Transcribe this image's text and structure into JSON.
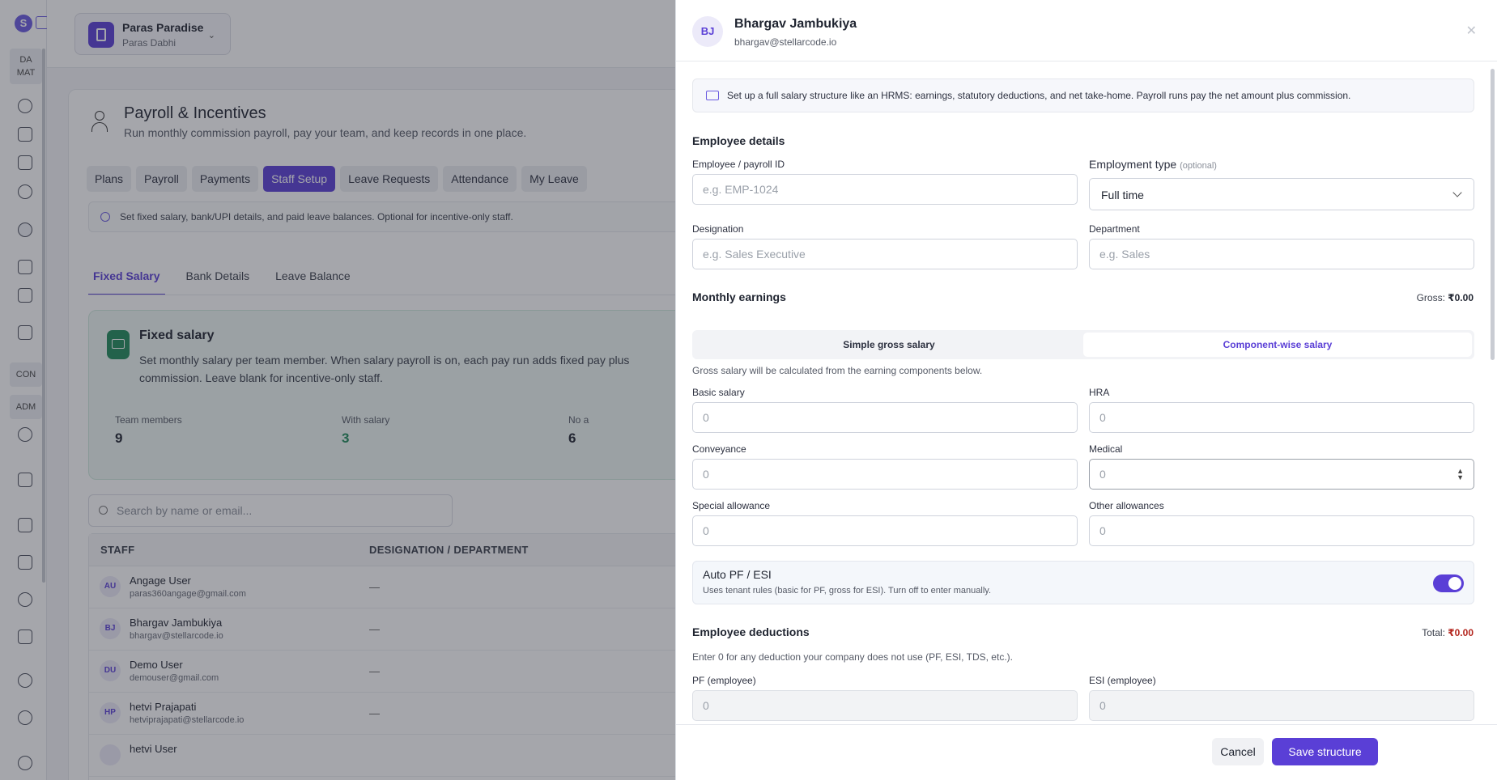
{
  "sidebar": {
    "sections": [
      "DA MAT",
      "CON",
      "ADM"
    ],
    "icons": [
      "dashboard-icon",
      "megaphone-icon",
      "document-icon",
      "users-icon",
      "payroll-icon",
      "building-icon",
      "presentation-icon",
      "checklist-icon",
      "whatsapp-icon",
      "phone-icon",
      "mail-icon",
      "receipt-icon",
      "network-icon",
      "ledger-icon",
      "user-add-icon",
      "help-user-icon",
      "profile-icon"
    ]
  },
  "org": {
    "name": "Paras Paradise",
    "owner": "Paras Dabhi"
  },
  "page": {
    "title": "Payroll & Incentives",
    "subtitle": "Run monthly commission payroll, pay your team, and keep records in one place."
  },
  "tabs": [
    "Plans",
    "Payroll",
    "Payments",
    "Staff Setup",
    "Leave Requests",
    "Attendance",
    "My Leave"
  ],
  "active_tab": "Staff Setup",
  "notice": "Set fixed salary, bank/UPI details, and paid leave balances. Optional for incentive-only staff.",
  "subtabs": [
    "Fixed Salary",
    "Bank Details",
    "Leave Balance"
  ],
  "fixed_card": {
    "title": "Fixed salary",
    "description": "Set monthly salary per team member. When salary payroll is on, each pay run adds fixed pay plus commission. Leave blank for incentive-only staff.",
    "stats": [
      {
        "label": "Team members",
        "value": "9"
      },
      {
        "label": "With salary",
        "value": "3"
      },
      {
        "label": "No a",
        "value": "6"
      }
    ]
  },
  "search": {
    "placeholder": "Search by name or email..."
  },
  "table": {
    "headers": [
      "STAFF",
      "DESIGNATION / DEPARTMENT"
    ],
    "rows": [
      {
        "initials": "AU",
        "name": "Angage User",
        "email": "paras360angage@gmail.com",
        "designation": "—"
      },
      {
        "initials": "BJ",
        "name": "Bhargav Jambukiya",
        "email": "bhargav@stellarcode.io",
        "designation": "—"
      },
      {
        "initials": "DU",
        "name": "Demo User",
        "email": "demouser@gmail.com",
        "designation": "—"
      },
      {
        "initials": "HP",
        "name": "hetvi Prajapati",
        "email": "hetviprajapati@stellarcode.io",
        "designation": "—"
      },
      {
        "initials": "",
        "name": "hetvi User",
        "email": "",
        "designation": ""
      }
    ]
  },
  "drawer": {
    "initials": "BJ",
    "name": "Bhargav Jambukiya",
    "email": "bhargav@stellarcode.io",
    "info": "Set up a full salary structure like an HRMS: earnings, statutory deductions, and net take-home. Payroll runs pay the net amount plus commission.",
    "employee_details": {
      "heading": "Employee details",
      "payroll_id_label": "Employee / payroll ID",
      "payroll_id_placeholder": "e.g. EMP-1024",
      "employment_type_label": "Employment type",
      "employment_type_optional": "(optional)",
      "employment_type_value": "Full time",
      "designation_label": "Designation",
      "designation_placeholder": "e.g. Sales Executive",
      "department_label": "Department",
      "department_placeholder": "e.g. Sales"
    },
    "earnings": {
      "heading": "Monthly earnings",
      "gross_label": "Gross:",
      "gross_value": "₹0.00",
      "modes": [
        "Simple gross salary",
        "Component-wise salary"
      ],
      "active_mode": "Component-wise salary",
      "hint": "Gross salary will be calculated from the earning components below.",
      "fields": [
        {
          "label": "Basic salary",
          "placeholder": "0"
        },
        {
          "label": "HRA",
          "placeholder": "0"
        },
        {
          "label": "Conveyance",
          "placeholder": "0"
        },
        {
          "label": "Medical",
          "placeholder": "0"
        },
        {
          "label": "Special allowance",
          "placeholder": "0"
        },
        {
          "label": "Other allowances",
          "placeholder": "0"
        }
      ]
    },
    "auto_pf": {
      "title": "Auto PF / ESI",
      "subtitle": "Uses tenant rules (basic for PF, gross for ESI). Turn off to enter manually.",
      "enabled": true
    },
    "deductions": {
      "heading": "Employee deductions",
      "total_label": "Total:",
      "total_value": "₹0.00",
      "hint": "Enter 0 for any deduction your company does not use (PF, ESI, TDS, etc.).",
      "fields": [
        {
          "label": "PF (employee)",
          "placeholder": "0"
        },
        {
          "label": "ESI (employee)",
          "placeholder": "0"
        }
      ]
    },
    "cancel_label": "Cancel",
    "save_label": "Save structure"
  }
}
